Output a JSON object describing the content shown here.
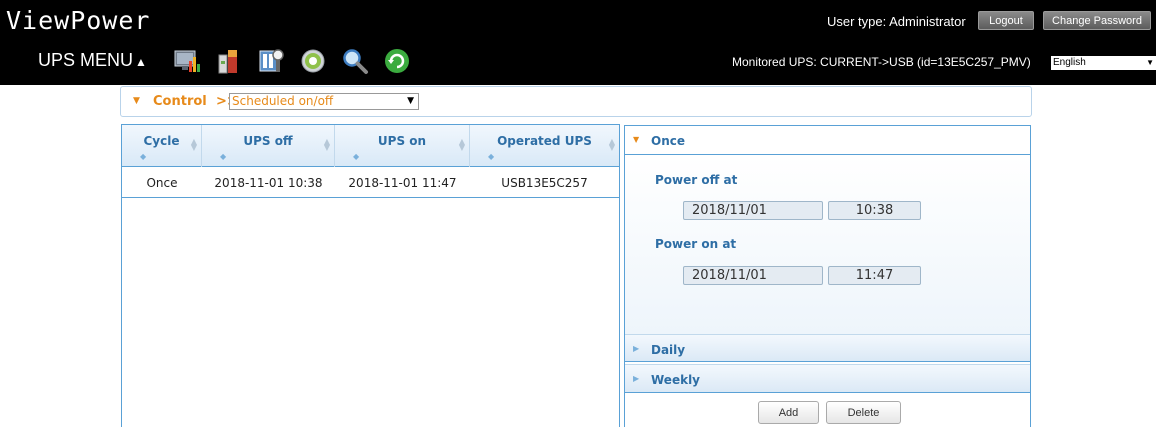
{
  "header": {
    "app_title": "ViewPower",
    "menu_label": "UPS MENU",
    "menu_caret": "▲",
    "user_type": "User type: Administrator",
    "logout_label": "Logout",
    "change_password_label": "Change Password",
    "monitored_text": "Monitored UPS: CURRENT->USB (id=13E5C257_PMV)",
    "language": "English",
    "toolbar_icons": [
      "monitor-icon",
      "battery-icon",
      "settings-icon",
      "disc-icon",
      "search-icon",
      "refresh-icon"
    ]
  },
  "control": {
    "label": "Control",
    "separator": ">>",
    "mode": "Scheduled on/off"
  },
  "table": {
    "columns": [
      "Cycle",
      "UPS off",
      "UPS on",
      "Operated UPS"
    ],
    "rows": [
      [
        "Once",
        "2018-11-01 10:38",
        "2018-11-01 11:47",
        "USB13E5C257"
      ]
    ]
  },
  "detail": {
    "once_label": "Once",
    "power_off_label": "Power off at",
    "power_off_date": "2018/11/01",
    "power_off_time": "10:38",
    "power_on_label": "Power on at",
    "power_on_date": "2018/11/01",
    "power_on_time": "11:47",
    "daily_label": "Daily",
    "weekly_label": "Weekly",
    "add_label": "Add",
    "delete_label": "Delete"
  },
  "colors": {
    "accent_orange": "#e78a1a",
    "panel_blue": "#2e6ea5",
    "border_blue": "#5aa1d6",
    "header_bg": "#000000"
  }
}
